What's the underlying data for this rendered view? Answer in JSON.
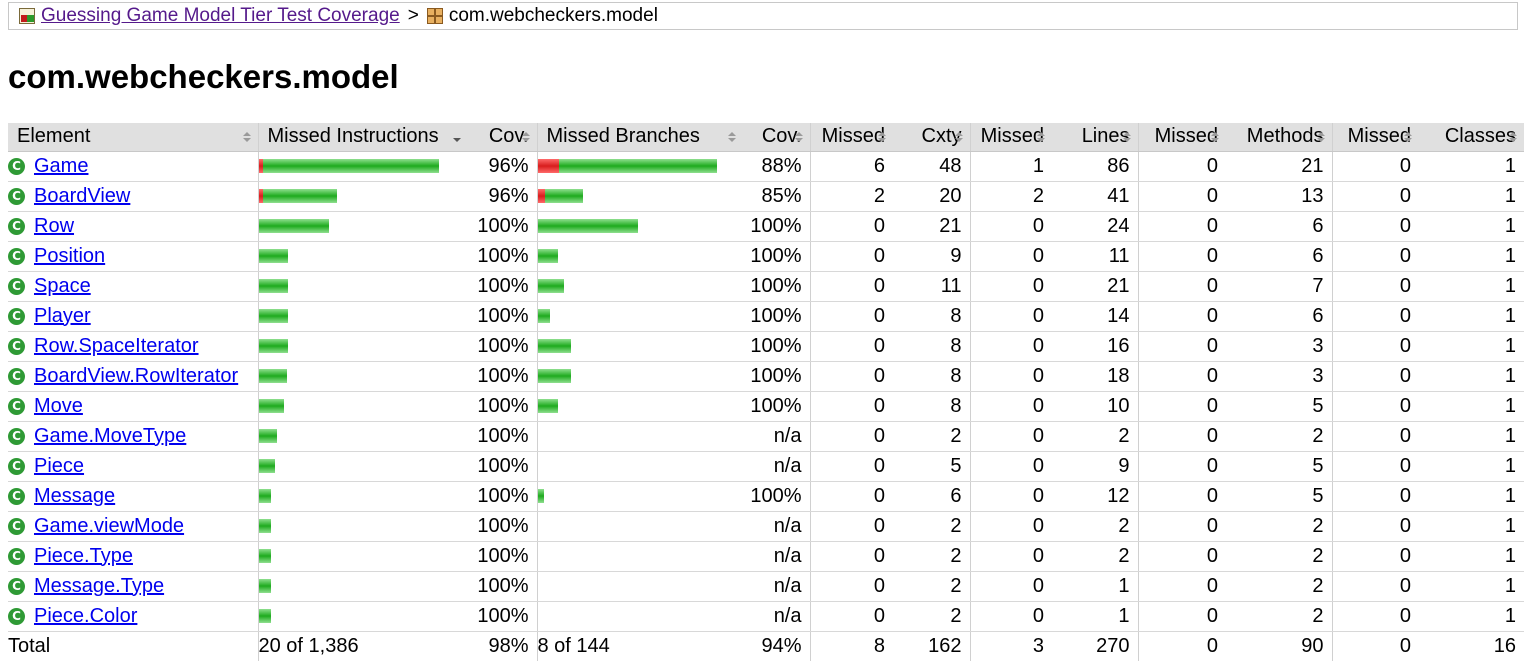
{
  "breadcrumb": {
    "report_link": "Guessing Game Model Tier Test Coverage",
    "separator": ">",
    "current": "com.webcheckers.model"
  },
  "page_title": "com.webcheckers.model",
  "table": {
    "headers": {
      "element": "Element",
      "missed_instructions": "Missed Instructions",
      "instr_cov": "Cov.",
      "missed_branches": "Missed Branches",
      "branch_cov": "Cov.",
      "missed_cxty": "Missed",
      "cxty": "Cxty",
      "missed_lines": "Missed",
      "lines": "Lines",
      "missed_methods": "Missed",
      "methods": "Methods",
      "missed_classes": "Missed",
      "classes": "Classes"
    },
    "rows": [
      {
        "name": "Game",
        "icon": "class-icon",
        "instr_bar": {
          "missed": 0.014,
          "covered": 0.986,
          "scale": 1.0
        },
        "instr_cov": "96%",
        "branch_bar": {
          "missed": 0.12,
          "covered": 0.88,
          "scale": 1.0
        },
        "branch_cov": "88%",
        "missed_cxty": "6",
        "cxty": "48",
        "missed_lines": "1",
        "lines": "86",
        "missed_methods": "0",
        "methods": "21",
        "missed_classes": "0",
        "classes": "1"
      },
      {
        "name": "BoardView",
        "icon": "class-icon",
        "instr_bar": {
          "missed": 0.015,
          "covered": 0.985,
          "scale": 0.435
        },
        "instr_cov": "96%",
        "branch_bar": {
          "missed": 0.15,
          "covered": 0.85,
          "scale": 0.253
        },
        "branch_cov": "85%",
        "missed_cxty": "2",
        "cxty": "20",
        "missed_lines": "2",
        "lines": "41",
        "missed_methods": "0",
        "methods": "13",
        "missed_classes": "0",
        "classes": "1"
      },
      {
        "name": "Row",
        "icon": "class-icon",
        "instr_bar": {
          "missed": 0,
          "covered": 1,
          "scale": 0.39
        },
        "instr_cov": "100%",
        "branch_bar": {
          "missed": 0,
          "covered": 1,
          "scale": 0.556
        },
        "branch_cov": "100%",
        "missed_cxty": "0",
        "cxty": "21",
        "missed_lines": "0",
        "lines": "24",
        "missed_methods": "0",
        "methods": "6",
        "missed_classes": "0",
        "classes": "1"
      },
      {
        "name": "Position",
        "icon": "class-icon",
        "instr_bar": {
          "missed": 0,
          "covered": 1,
          "scale": 0.163
        },
        "instr_cov": "100%",
        "branch_bar": {
          "missed": 0,
          "covered": 1,
          "scale": 0.112
        },
        "branch_cov": "100%",
        "missed_cxty": "0",
        "cxty": "9",
        "missed_lines": "0",
        "lines": "11",
        "missed_methods": "0",
        "methods": "6",
        "missed_classes": "0",
        "classes": "1"
      },
      {
        "name": "Space",
        "icon": "class-icon",
        "instr_bar": {
          "missed": 0,
          "covered": 1,
          "scale": 0.163
        },
        "instr_cov": "100%",
        "branch_bar": {
          "missed": 0,
          "covered": 1,
          "scale": 0.146
        },
        "branch_cov": "100%",
        "missed_cxty": "0",
        "cxty": "11",
        "missed_lines": "0",
        "lines": "21",
        "missed_methods": "0",
        "methods": "7",
        "missed_classes": "0",
        "classes": "1"
      },
      {
        "name": "Player",
        "icon": "class-icon",
        "instr_bar": {
          "missed": 0,
          "covered": 1,
          "scale": 0.163
        },
        "instr_cov": "100%",
        "branch_bar": {
          "missed": 0,
          "covered": 1,
          "scale": 0.067
        },
        "branch_cov": "100%",
        "missed_cxty": "0",
        "cxty": "8",
        "missed_lines": "0",
        "lines": "14",
        "missed_methods": "0",
        "methods": "6",
        "missed_classes": "0",
        "classes": "1"
      },
      {
        "name": "Row.SpaceIterator",
        "icon": "class-icon",
        "instr_bar": {
          "missed": 0,
          "covered": 1,
          "scale": 0.163
        },
        "instr_cov": "100%",
        "branch_bar": {
          "missed": 0,
          "covered": 1,
          "scale": 0.185
        },
        "branch_cov": "100%",
        "missed_cxty": "0",
        "cxty": "8",
        "missed_lines": "0",
        "lines": "16",
        "missed_methods": "0",
        "methods": "3",
        "missed_classes": "0",
        "classes": "1"
      },
      {
        "name": "BoardView.RowIterator",
        "icon": "class-icon",
        "instr_bar": {
          "missed": 0,
          "covered": 1,
          "scale": 0.157
        },
        "instr_cov": "100%",
        "branch_bar": {
          "missed": 0,
          "covered": 1,
          "scale": 0.185
        },
        "branch_cov": "100%",
        "missed_cxty": "0",
        "cxty": "8",
        "missed_lines": "0",
        "lines": "18",
        "missed_methods": "0",
        "methods": "3",
        "missed_classes": "0",
        "classes": "1"
      },
      {
        "name": "Move",
        "icon": "class-icon",
        "instr_bar": {
          "missed": 0,
          "covered": 1,
          "scale": 0.14
        },
        "instr_cov": "100%",
        "branch_bar": {
          "missed": 0,
          "covered": 1,
          "scale": 0.112
        },
        "branch_cov": "100%",
        "missed_cxty": "0",
        "cxty": "8",
        "missed_lines": "0",
        "lines": "10",
        "missed_methods": "0",
        "methods": "5",
        "missed_classes": "0",
        "classes": "1"
      },
      {
        "name": "Game.MoveType",
        "icon": "class-icon",
        "instr_bar": {
          "missed": 0,
          "covered": 1,
          "scale": 0.101
        },
        "instr_cov": "100%",
        "branch_bar": null,
        "branch_cov": "n/a",
        "missed_cxty": "0",
        "cxty": "2",
        "missed_lines": "0",
        "lines": "2",
        "missed_methods": "0",
        "methods": "2",
        "missed_classes": "0",
        "classes": "1"
      },
      {
        "name": "Piece",
        "icon": "class-icon",
        "instr_bar": {
          "missed": 0,
          "covered": 1,
          "scale": 0.09
        },
        "instr_cov": "100%",
        "branch_bar": null,
        "branch_cov": "n/a",
        "missed_cxty": "0",
        "cxty": "5",
        "missed_lines": "0",
        "lines": "9",
        "missed_methods": "0",
        "methods": "5",
        "missed_classes": "0",
        "classes": "1"
      },
      {
        "name": "Message",
        "icon": "class-icon",
        "instr_bar": {
          "missed": 0,
          "covered": 1,
          "scale": 0.067
        },
        "instr_cov": "100%",
        "branch_bar": {
          "missed": 0,
          "covered": 1,
          "scale": 0.034
        },
        "branch_cov": "100%",
        "missed_cxty": "0",
        "cxty": "6",
        "missed_lines": "0",
        "lines": "12",
        "missed_methods": "0",
        "methods": "5",
        "missed_classes": "0",
        "classes": "1"
      },
      {
        "name": "Game.viewMode",
        "icon": "class-icon",
        "instr_bar": {
          "missed": 0,
          "covered": 1,
          "scale": 0.067
        },
        "instr_cov": "100%",
        "branch_bar": null,
        "branch_cov": "n/a",
        "missed_cxty": "0",
        "cxty": "2",
        "missed_lines": "0",
        "lines": "2",
        "missed_methods": "0",
        "methods": "2",
        "missed_classes": "0",
        "classes": "1"
      },
      {
        "name": "Piece.Type",
        "icon": "class-icon",
        "instr_bar": {
          "missed": 0,
          "covered": 1,
          "scale": 0.067
        },
        "instr_cov": "100%",
        "branch_bar": null,
        "branch_cov": "n/a",
        "missed_cxty": "0",
        "cxty": "2",
        "missed_lines": "0",
        "lines": "2",
        "missed_methods": "0",
        "methods": "2",
        "missed_classes": "0",
        "classes": "1"
      },
      {
        "name": "Message.Type",
        "icon": "class-icon",
        "instr_bar": {
          "missed": 0,
          "covered": 1,
          "scale": 0.067
        },
        "instr_cov": "100%",
        "branch_bar": null,
        "branch_cov": "n/a",
        "missed_cxty": "0",
        "cxty": "2",
        "missed_lines": "0",
        "lines": "1",
        "missed_methods": "0",
        "methods": "2",
        "missed_classes": "0",
        "classes": "1"
      },
      {
        "name": "Piece.Color",
        "icon": "class-icon",
        "instr_bar": {
          "missed": 0,
          "covered": 1,
          "scale": 0.067
        },
        "instr_cov": "100%",
        "branch_bar": null,
        "branch_cov": "n/a",
        "missed_cxty": "0",
        "cxty": "2",
        "missed_lines": "0",
        "lines": "1",
        "missed_methods": "0",
        "methods": "2",
        "missed_classes": "0",
        "classes": "1"
      }
    ],
    "total": {
      "label": "Total",
      "missed_instructions": "20 of 1,386",
      "instr_cov": "98%",
      "missed_branches": "8 of 144",
      "branch_cov": "94%",
      "missed_cxty": "8",
      "cxty": "162",
      "missed_lines": "3",
      "lines": "270",
      "missed_methods": "0",
      "methods": "90",
      "missed_classes": "0",
      "classes": "16"
    }
  },
  "colors": {
    "missed_bar": "#d81d1d",
    "covered_bar": "#1eaa1e",
    "header_bg": "#e0e0e0",
    "link": "#0000ee",
    "visited_link": "#551a8b"
  }
}
